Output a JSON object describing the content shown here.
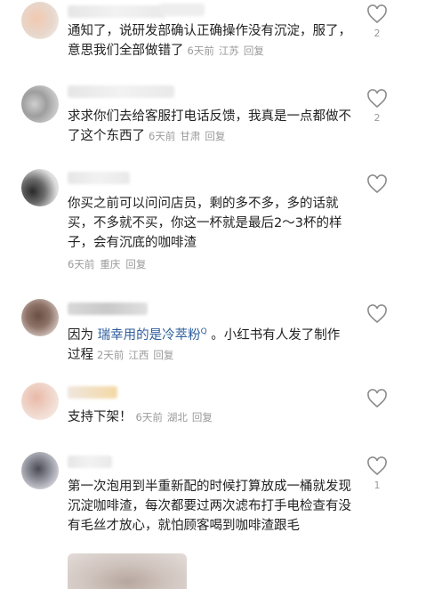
{
  "comments": [
    {
      "text": "通知了，说研发部确认正确操作没有沉淀，服了，意思我们全部做错了",
      "time": "6天前",
      "location": "江苏",
      "reply_label": "回复",
      "likes": "2"
    },
    {
      "text": "求求你们去给客服打电话反馈，我真是一点都做不了这个东西了",
      "time": "6天前",
      "location": "甘肃",
      "reply_label": "回复",
      "likes": "2"
    },
    {
      "text": "你买之前可以问问店员，剩的多不多，多的话就买，不多就不买，你这一杯就是最后2～3杯的样子，会有沉底的咖啡渣",
      "time": "6天前",
      "location": "重庆",
      "reply_label": "回复",
      "likes": ""
    },
    {
      "text_before": "因为 ",
      "link_text": "瑞幸用的是冷萃粉",
      "text_after": " 。小红书有人发了制作过程",
      "time": "2天前",
      "location": "江西",
      "reply_label": "回复",
      "likes": ""
    },
    {
      "text": "支持下架！",
      "time": "6天前",
      "location": "湖北",
      "reply_label": "回复",
      "likes": ""
    },
    {
      "text": "第一次泡用到半重新配的时候打算放成一桶就发现沉淀咖啡渣，每次都要过两次滤布打手电检查有没有毛丝才放心，就怕顾客喝到咖啡渣跟毛",
      "time": "",
      "location": "",
      "reply_label": "",
      "likes": "1"
    }
  ],
  "icons": {
    "like": "heart-outline-icon",
    "search_link": "search-small-icon"
  },
  "colors": {
    "text": "#222222",
    "meta": "#9a9a9a",
    "link": "#2e5d9c",
    "icon": "#8a8a8a"
  }
}
